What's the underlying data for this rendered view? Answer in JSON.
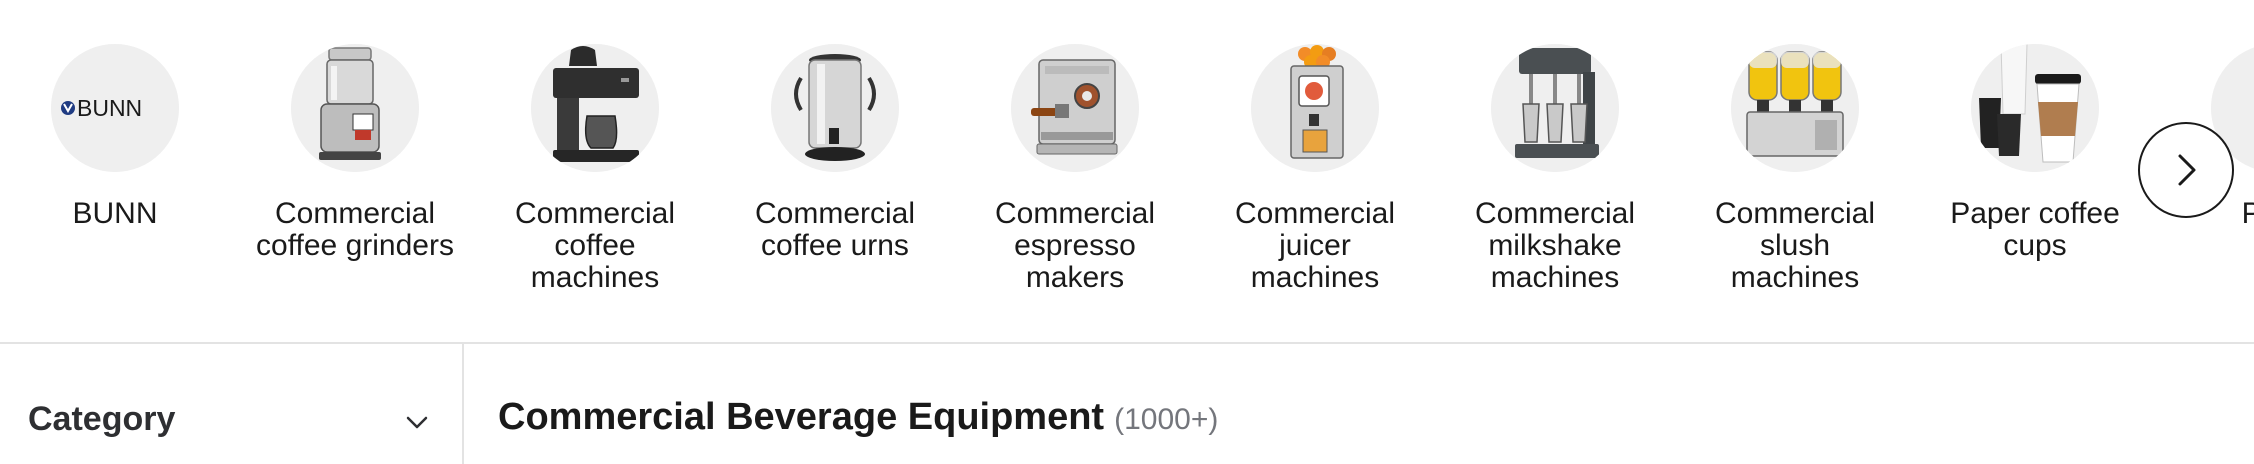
{
  "categories": [
    {
      "label": "BUNN",
      "icon": "bunn-logo"
    },
    {
      "label": "Commercial coffee grinders",
      "icon": "coffee-grinder-image"
    },
    {
      "label": "Commercial coffee machines",
      "icon": "coffee-machine-image"
    },
    {
      "label": "Commercial coffee urns",
      "icon": "coffee-urn-image"
    },
    {
      "label": "Commercial espresso makers",
      "icon": "espresso-maker-image"
    },
    {
      "label": "Commercial juicer machines",
      "icon": "juicer-machine-image"
    },
    {
      "label": "Commercial milkshake machines",
      "icon": "milkshake-machine-image"
    },
    {
      "label": "Commercial slush machines",
      "icon": "slush-machine-image"
    },
    {
      "label": "Paper coffee cups",
      "icon": "paper-cups-image"
    },
    {
      "label": "Plast",
      "icon": "plastic-cups-image"
    }
  ],
  "bunn_logo_text": "BUNN",
  "carousel_next_icon": "chevron-right-icon",
  "filter": {
    "title": "Category",
    "toggle_icon": "chevron-down-icon"
  },
  "results": {
    "title": "Commercial Beverage Equipment",
    "count": "(1000+)"
  },
  "colors": {
    "divider": "#e3e3e3",
    "thumb_bg": "#efefef",
    "count_text": "#74767c",
    "bunn_blue": "#1f3b82"
  }
}
